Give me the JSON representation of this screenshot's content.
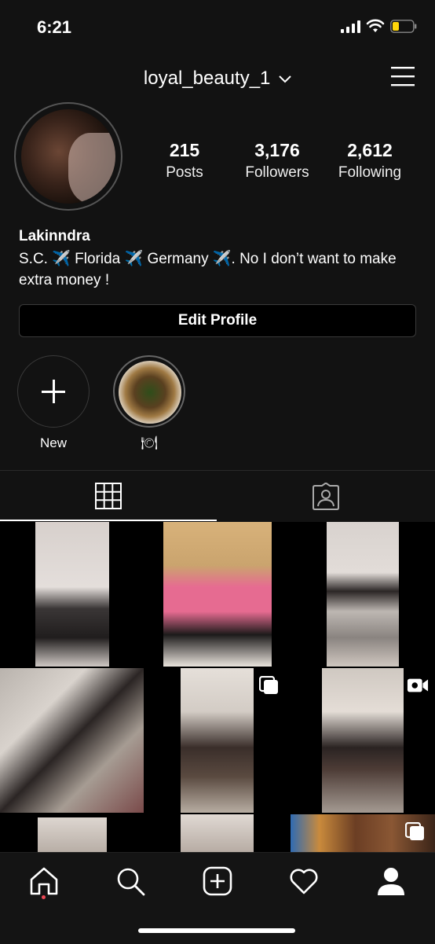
{
  "status_bar": {
    "time": "6:21"
  },
  "header": {
    "username": "loyal_beauty_1"
  },
  "profile": {
    "stats": [
      {
        "value": "215",
        "label": "Posts"
      },
      {
        "value": "3,176",
        "label": "Followers"
      },
      {
        "value": "2,612",
        "label": "Following"
      }
    ],
    "name": "Lakinndra",
    "bio": "S.C. ✈️ Florida ✈️ Germany ✈️. No I don’t want to make extra money !",
    "edit_button": "Edit Profile"
  },
  "highlights": [
    {
      "label": "New"
    },
    {
      "label": "🍽"
    }
  ],
  "tabs": [
    {
      "icon": "grid-icon",
      "active": true
    },
    {
      "icon": "tagged-icon",
      "active": false
    }
  ],
  "posts": [
    {
      "type": "photo"
    },
    {
      "type": "photo"
    },
    {
      "type": "photo"
    },
    {
      "type": "photo"
    },
    {
      "type": "carousel"
    },
    {
      "type": "video"
    },
    {
      "type": "photo"
    },
    {
      "type": "photo"
    },
    {
      "type": "carousel"
    }
  ],
  "bottom_nav": [
    {
      "icon": "home-icon",
      "active": true
    },
    {
      "icon": "search-icon"
    },
    {
      "icon": "add-post-icon"
    },
    {
      "icon": "heart-icon"
    },
    {
      "icon": "profile-icon"
    }
  ],
  "colors": {
    "background": "#121212",
    "notification_dot": "#ed4956",
    "text": "#ffffff"
  }
}
